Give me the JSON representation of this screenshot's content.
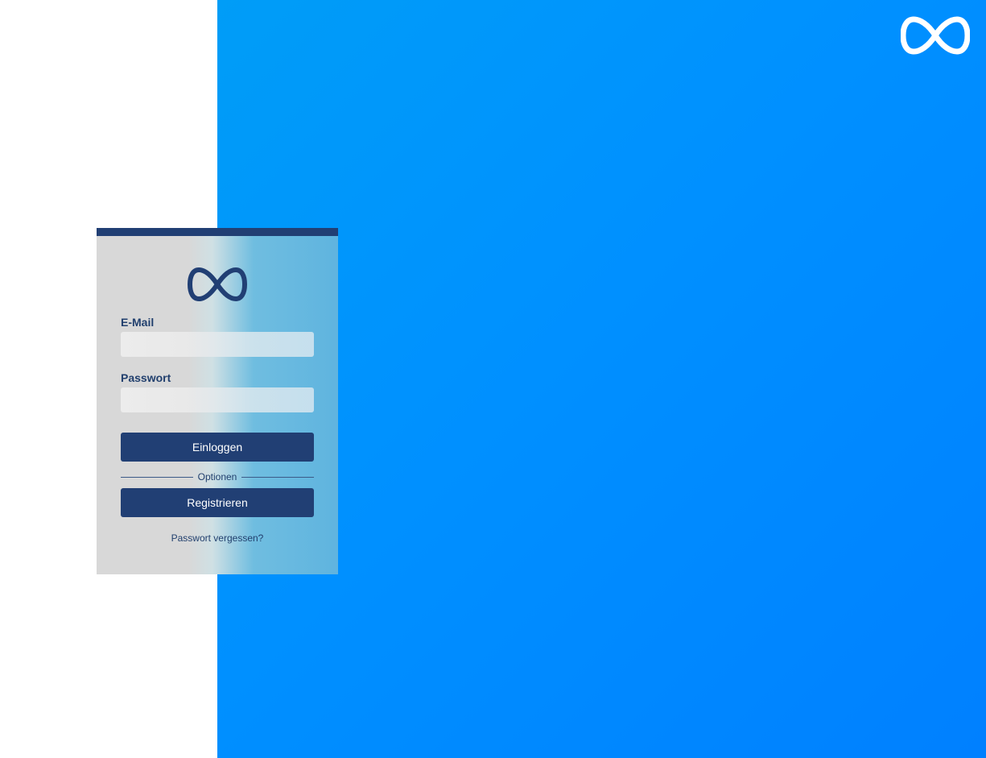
{
  "brand": {
    "logo_icon": "infinity-icon",
    "card_logo_color": "#213f74",
    "corner_logo_color": "#ffffff"
  },
  "colors": {
    "accent": "#213f74",
    "background_gradient_start": "#009df7",
    "background_gradient_end": "#0080ff"
  },
  "login": {
    "email_label": "E-Mail",
    "email_value": "",
    "email_placeholder": "",
    "password_label": "Passwort",
    "password_value": "",
    "password_placeholder": "",
    "login_button": "Einloggen",
    "divider_text": "Optionen",
    "register_button": "Registrieren",
    "forgot_password": "Passwort vergessen?"
  }
}
